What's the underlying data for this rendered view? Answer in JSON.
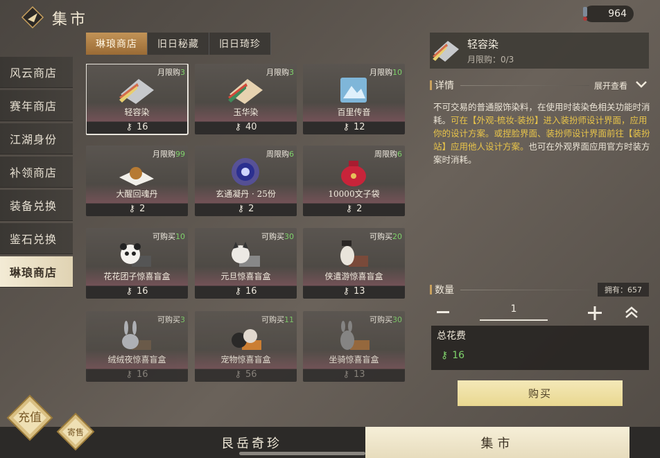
{
  "header": {
    "title": "集市",
    "currency_value": "964"
  },
  "left_nav": [
    {
      "label": "风云商店",
      "active": false
    },
    {
      "label": "赛年商店",
      "active": false
    },
    {
      "label": "江湖身份",
      "active": false
    },
    {
      "label": "补领商店",
      "active": false
    },
    {
      "label": "装备兑换",
      "active": false
    },
    {
      "label": "鉴石兑换",
      "active": false
    },
    {
      "label": "琳琅商店",
      "active": true
    }
  ],
  "shop_tabs": [
    {
      "label": "琳琅商店",
      "active": true
    },
    {
      "label": "旧日秘藏",
      "active": false
    },
    {
      "label": "旧日琦珍",
      "active": false
    }
  ],
  "items": [
    {
      "name": "轻容染",
      "limit_label": "月限购",
      "limit_num": "3",
      "price": "16",
      "icon": "fabric-icon"
    },
    {
      "name": "玉华染",
      "limit_label": "月限购",
      "limit_num": "3",
      "price": "40",
      "icon": "fabric-icon"
    },
    {
      "name": "百里传音",
      "limit_label": "月限购",
      "limit_num": "10",
      "price": "12",
      "icon": "scroll-icon"
    },
    {
      "name": "大醒回魂丹",
      "limit_label": "月限购",
      "limit_num": "99",
      "price": "2",
      "icon": "pill-icon"
    },
    {
      "name": "玄通凝丹 · 25份",
      "limit_label": "周限购",
      "limit_num": "6",
      "price": "2",
      "icon": "orb-icon"
    },
    {
      "name": "10000文子袋",
      "limit_label": "周限购",
      "limit_num": "6",
      "price": "2",
      "icon": "pouch-icon"
    },
    {
      "name": "花花团子惊喜盲盒",
      "limit_label": "可购买",
      "limit_num": "10",
      "price": "16",
      "icon": "panda-box-icon"
    },
    {
      "name": "元旦惊喜盲盒",
      "limit_label": "可购买",
      "limit_num": "30",
      "price": "16",
      "icon": "cat-box-icon"
    },
    {
      "name": "侠遣游惊喜盲盒",
      "limit_label": "可购买",
      "limit_num": "20",
      "price": "13",
      "icon": "horse-box-icon"
    },
    {
      "name": "绒绒夜惊喜盲盒",
      "limit_label": "可购买",
      "limit_num": "3",
      "price": "16",
      "icon": "rabbit-box-icon"
    },
    {
      "name": "宠物惊喜盲盒",
      "limit_label": "可购买",
      "limit_num": "11",
      "price": "56",
      "icon": "pet-box-icon"
    },
    {
      "name": "坐骑惊喜盲盒",
      "limit_label": "可购买",
      "limit_num": "30",
      "price": "13",
      "icon": "donkey-box-icon"
    }
  ],
  "detail": {
    "name": "轻容染",
    "limit": "月限购：0/3",
    "section_title": "详情",
    "expand_label": "展开查看",
    "desc_plain": "不可交易的普通服饰染料，在使用时装染色相关功能时消耗。",
    "desc_hl": "可在【外观-梳妆-装扮】进入装扮师设计界面，应用你的设计方案。或捏脸界面、装扮师设计界面前往【装扮站】应用他人设计方案。",
    "desc_tail": "也可在外观界面应用官方时装方案时消耗。"
  },
  "quantity": {
    "label": "数量",
    "owned": "拥有：657",
    "value": "1"
  },
  "cost": {
    "label": "总花费",
    "value": "16"
  },
  "buy_label": "购买",
  "bottom_tabs": {
    "left": "艮岳奇珍",
    "right": "集市"
  },
  "corner": {
    "recharge": "充值",
    "consign": "寄售"
  },
  "colors": {
    "limit_green": "#7fd36b",
    "accent_gold": "#c9a15e",
    "highlight_yellow": "#e8c44a"
  }
}
